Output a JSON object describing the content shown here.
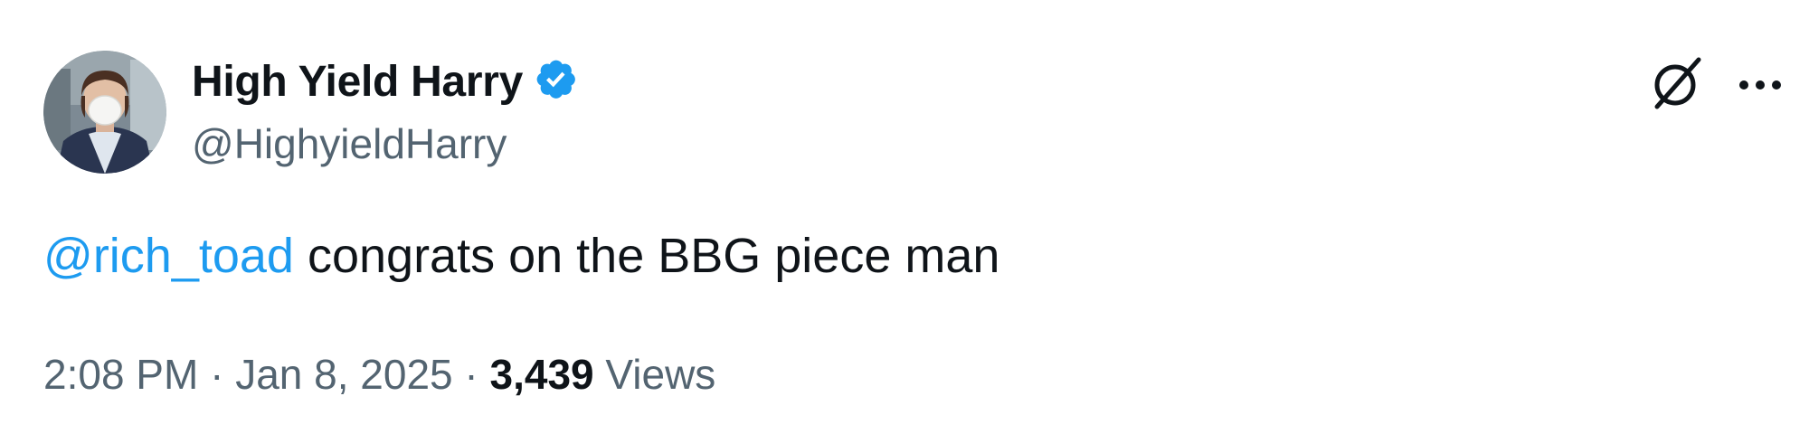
{
  "author": {
    "display_name": "High Yield Harry",
    "handle": "@HighyieldHarry",
    "verified": true,
    "verified_color": "#1d9bf0"
  },
  "tweet": {
    "mention": "@rich_toad",
    "text": " congrats on the BBG piece man"
  },
  "meta": {
    "time": "2:08 PM",
    "separator": " · ",
    "date": "Jan 8, 2025",
    "views_count": "3,439",
    "views_label": " Views"
  },
  "actions": {
    "grok_icon": "grok-icon",
    "more_icon": "more-options-icon"
  },
  "colors": {
    "text_primary": "#0f1419",
    "text_secondary": "#536471",
    "link": "#1d9bf0"
  }
}
